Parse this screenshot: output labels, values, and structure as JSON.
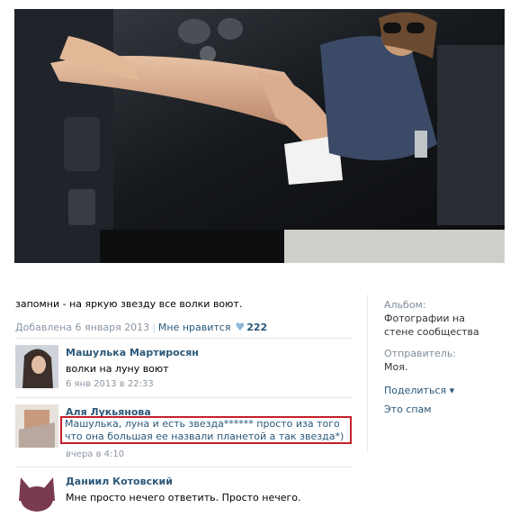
{
  "post": {
    "caption": "запомни - на яркую звезду все волки воют.",
    "date": "Добавлена 6 января 2013",
    "like_label": "Мне нравится",
    "like_count": "222"
  },
  "sidebar": {
    "album_label": "Альбом:",
    "album_value": "Фотографии на стене сообщества",
    "sender_label": "Отправитель:",
    "sender_value": "Моя.",
    "share_label": "Поделиться",
    "spam_label": "Это спам"
  },
  "comments": [
    {
      "author": "Машулька Мартиросян",
      "text": "волки на луну воют",
      "date": "6 янв 2013 в 22:33"
    },
    {
      "author": "Аля Лукьянова",
      "text": "Машулька, луна и есть звезда****** просто иза того что она большая ее назвали планетой а так звезда*)",
      "date": "вчера в 4:10"
    },
    {
      "author": "Даниил Котовский",
      "text": "Мне просто нечего ответить. Просто нечего."
    }
  ],
  "colors": {
    "link": "#2b587a",
    "muted": "#8a96a3",
    "highlight_border": "#c4202a"
  },
  "icons": {
    "heart": "heart-icon",
    "share_arrow": "caret-down-icon"
  }
}
